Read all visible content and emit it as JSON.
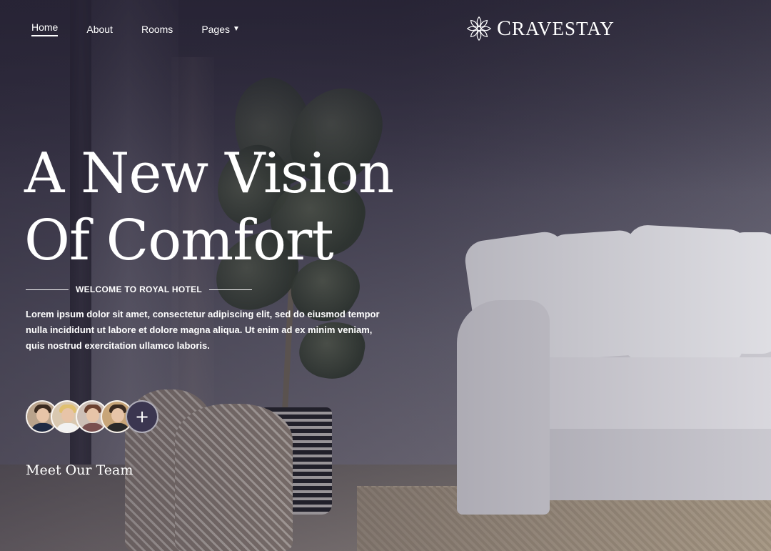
{
  "nav": {
    "items": [
      {
        "label": "Home",
        "active": true
      },
      {
        "label": "About"
      },
      {
        "label": "Rooms"
      },
      {
        "label": "Pages",
        "has_dropdown": true
      }
    ]
  },
  "brand": {
    "logo_icon": "mandala-flower-icon",
    "name": "Cravestay"
  },
  "hero": {
    "title_line1": "A New Vision",
    "title_line2": "Of Comfort",
    "tagline": "WELCOME TO ROYAL HOTEL",
    "description": "Lorem ipsum dolor sit amet, consectetur adipiscing elit, sed do eiusmod tempor nulla incididunt ut labore et dolore magna aliqua. Ut enim ad ex minim veniam, quis nostrud exercitation ullamco laboris.",
    "background_image": "living-room-with-white-sofa-and-monstera-plant"
  },
  "team": {
    "avatars": [
      "man-in-suit",
      "blonde-woman",
      "woman-with-brown-hair",
      "man-in-vest"
    ],
    "add_button_symbol": "+",
    "link_label": "Meet Our Team"
  },
  "colors": {
    "overlay": "#2a2638",
    "add_button": "#3b3650",
    "text": "#ffffff"
  }
}
